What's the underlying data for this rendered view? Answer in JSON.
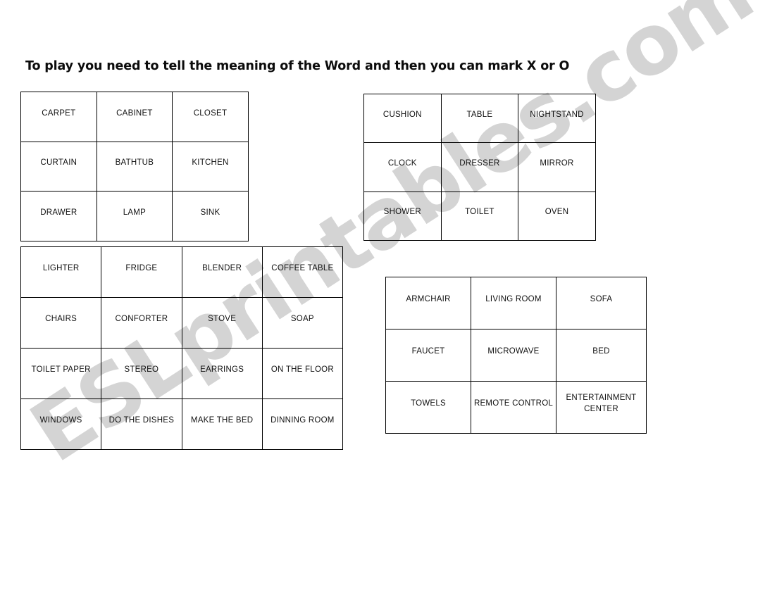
{
  "page": {
    "title": "To play you need to tell the meaning of the Word and then you can mark X or O",
    "watermark": "ESLprintables.com",
    "watermark_color": "#d4d4d4",
    "background_color": "#ffffff",
    "border_color": "#000000",
    "text_color": "#111111"
  },
  "cards": [
    {
      "id": "card-a",
      "name": "bingo-card-1",
      "columns": 3,
      "rows": 3,
      "cells": [
        [
          "CARPET",
          "CABINET",
          "CLOSET"
        ],
        [
          "CURTAIN",
          "BATHTUB",
          "KITCHEN"
        ],
        [
          "DRAWER",
          "LAMP",
          "SINK"
        ]
      ]
    },
    {
      "id": "card-b",
      "name": "bingo-card-2",
      "columns": 3,
      "rows": 3,
      "cells": [
        [
          "CUSHION",
          "TABLE",
          "NIGHTSTAND"
        ],
        [
          "CLOCK",
          "DRESSER",
          "MIRROR"
        ],
        [
          "SHOWER",
          "TOILET",
          "OVEN"
        ]
      ]
    },
    {
      "id": "card-c",
      "name": "bingo-card-3",
      "columns": 4,
      "rows": 4,
      "cells": [
        [
          "LIGHTER",
          "FRIDGE",
          "BLENDER",
          "COFFEE TABLE"
        ],
        [
          "CHAIRS",
          "CONFORTER",
          "STOVE",
          "SOAP"
        ],
        [
          "TOILET PAPER",
          "STEREO",
          "EARRINGS",
          "ON THE FLOOR"
        ],
        [
          "WINDOWS",
          "DO THE DISHES",
          "MAKE THE BED",
          "DINNING ROOM"
        ]
      ]
    },
    {
      "id": "card-d",
      "name": "bingo-card-4",
      "columns": 3,
      "rows": 3,
      "cells": [
        [
          "ARMCHAIR",
          "LIVING ROOM",
          "SOFA"
        ],
        [
          "FAUCET",
          "MICROWAVE",
          "BED"
        ],
        [
          "TOWELS",
          "REMOTE CONTROL",
          "ENTERTAINMENT CENTER"
        ]
      ]
    }
  ]
}
